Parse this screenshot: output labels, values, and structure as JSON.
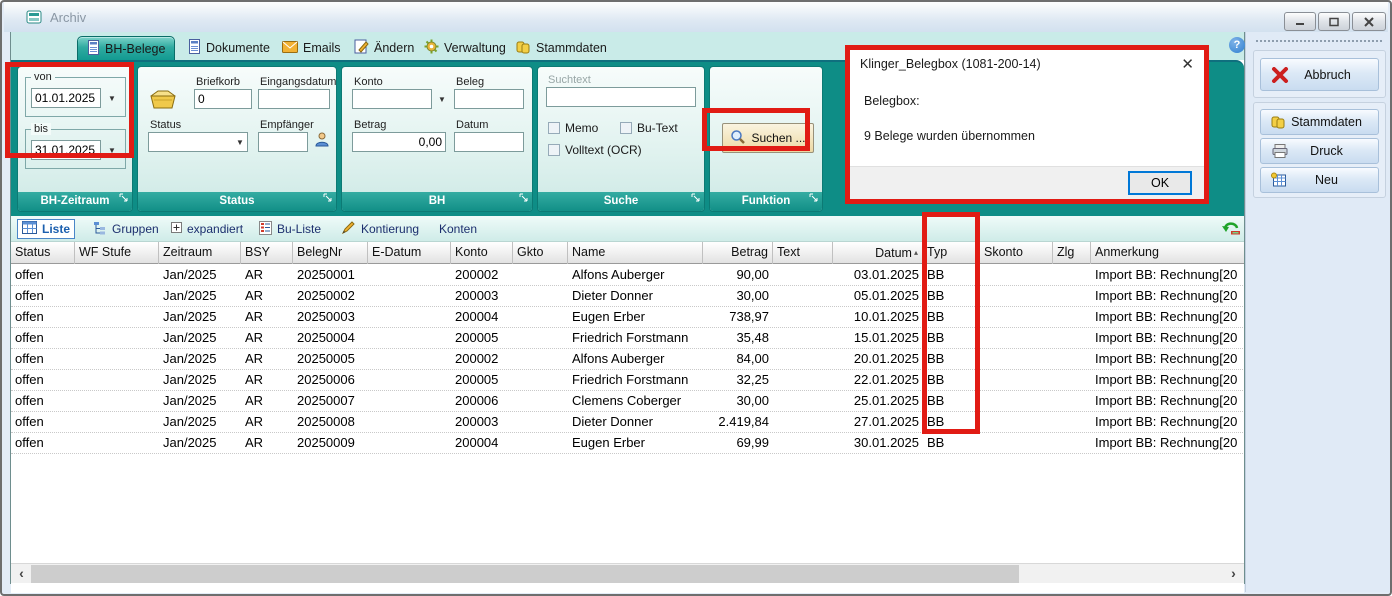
{
  "window": {
    "title": "Archiv"
  },
  "tabs": [
    {
      "label": "BH-Belege",
      "active": true
    },
    {
      "label": "Dokumente",
      "active": false
    },
    {
      "label": "Emails",
      "active": false
    },
    {
      "label": "Ändern",
      "active": false
    },
    {
      "label": "Verwaltung",
      "active": false
    },
    {
      "label": "Stammdaten",
      "active": false
    }
  ],
  "help_icon": "?",
  "ribbon": {
    "bh_zeitraum": {
      "title": "BH-Zeitraum",
      "von_label": "von",
      "von_value": "01.01.2025",
      "bis_label": "bis",
      "bis_value": "31.01.2025"
    },
    "status": {
      "title": "Status",
      "briefkorb_label": "Briefkorb",
      "briefkorb_value": "0",
      "eingangsdatum_label": "Eingangsdatum",
      "eingangsdatum_value": "",
      "status_label": "Status",
      "status_value": "",
      "empfaenger_label": "Empfänger",
      "empfaenger_value": ""
    },
    "bh": {
      "title": "BH",
      "konto_label": "Konto",
      "konto_value": "",
      "beleg_label": "Beleg",
      "beleg_value": "",
      "betrag_label": "Betrag",
      "betrag_value": "0,00",
      "datum_label": "Datum",
      "datum_value": ""
    },
    "suche": {
      "title": "Suche",
      "suchtext_label": "Suchtext",
      "suchtext_value": "",
      "memo_label": "Memo",
      "bu_text_label": "Bu-Text",
      "volltext_label": "Volltext (OCR)"
    },
    "funktion": {
      "title": "Funktion",
      "suchen_label": "Suchen ..."
    }
  },
  "view_toolbar": {
    "items": [
      "Liste",
      "Gruppen",
      "expandiert",
      "Bu-Liste",
      "Kontierung",
      "Konten"
    ],
    "active": "Liste"
  },
  "table": {
    "columns": [
      "Status",
      "WF Stufe",
      "Zeitraum",
      "BSY",
      "BelegNr",
      "E-Datum",
      "Konto",
      "Gkto",
      "Name",
      "Betrag",
      "Text",
      "Datum",
      "Typ",
      "Skonto",
      "Zlg",
      "Anmerkung"
    ],
    "sorted_by": "Datum",
    "rows": [
      [
        "offen",
        "",
        "Jan/2025",
        "AR",
        "20250001",
        "",
        "200002",
        "",
        "Alfons Auberger",
        "90,00",
        "",
        "03.01.2025",
        "BB",
        "",
        "",
        "Import BB: Rechnung[20"
      ],
      [
        "offen",
        "",
        "Jan/2025",
        "AR",
        "20250002",
        "",
        "200003",
        "",
        "Dieter Donner",
        "30,00",
        "",
        "05.01.2025",
        "BB",
        "",
        "",
        "Import BB: Rechnung[20"
      ],
      [
        "offen",
        "",
        "Jan/2025",
        "AR",
        "20250003",
        "",
        "200004",
        "",
        "Eugen Erber",
        "738,97",
        "",
        "10.01.2025",
        "BB",
        "",
        "",
        "Import BB: Rechnung[20"
      ],
      [
        "offen",
        "",
        "Jan/2025",
        "AR",
        "20250004",
        "",
        "200005",
        "",
        "Friedrich Forstmann",
        "35,48",
        "",
        "15.01.2025",
        "BB",
        "",
        "",
        "Import BB: Rechnung[20"
      ],
      [
        "offen",
        "",
        "Jan/2025",
        "AR",
        "20250005",
        "",
        "200002",
        "",
        "Alfons Auberger",
        "84,00",
        "",
        "20.01.2025",
        "BB",
        "",
        "",
        "Import BB: Rechnung[20"
      ],
      [
        "offen",
        "",
        "Jan/2025",
        "AR",
        "20250006",
        "",
        "200005",
        "",
        "Friedrich Forstmann",
        "32,25",
        "",
        "22.01.2025",
        "BB",
        "",
        "",
        "Import BB: Rechnung[20"
      ],
      [
        "offen",
        "",
        "Jan/2025",
        "AR",
        "20250007",
        "",
        "200006",
        "",
        "Clemens Coberger",
        "30,00",
        "",
        "25.01.2025",
        "BB",
        "",
        "",
        "Import BB: Rechnung[20"
      ],
      [
        "offen",
        "",
        "Jan/2025",
        "AR",
        "20250008",
        "",
        "200003",
        "",
        "Dieter Donner",
        "2.419,84",
        "",
        "27.01.2025",
        "BB",
        "",
        "",
        "Import BB: Rechnung[20"
      ],
      [
        "offen",
        "",
        "Jan/2025",
        "AR",
        "20250009",
        "",
        "200004",
        "",
        "Eugen Erber",
        "69,99",
        "",
        "30.01.2025",
        "BB",
        "",
        "",
        "Import BB: Rechnung[20"
      ]
    ]
  },
  "dialog": {
    "title": "Klinger_Belegbox (1081-200-14)",
    "line1": "Belegbox:",
    "line2": "9 Belege wurden übernommen",
    "ok_label": "OK"
  },
  "right_panel": {
    "abbruch_label": "Abbruch",
    "stammdaten_label": "Stammdaten",
    "druck_label": "Druck",
    "neu_label": "Neu"
  },
  "colors": {
    "ribbon_teal": "#0e8d86",
    "group_footer_teal": "#14948c",
    "annotation_red": "#e11b14",
    "accent_blue": "#0078d7"
  }
}
